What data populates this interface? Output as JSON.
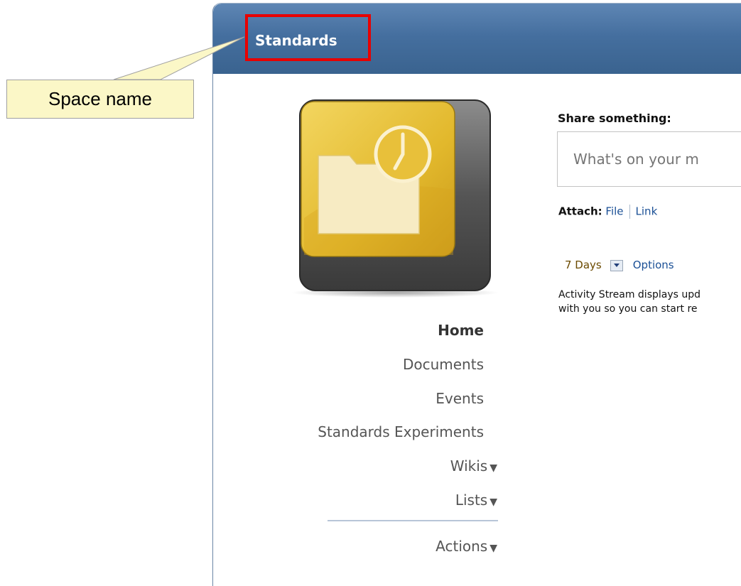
{
  "space": {
    "title": "Standards"
  },
  "callout": {
    "label": "Space name"
  },
  "nav": {
    "items": [
      {
        "label": "Home",
        "active": true,
        "has_menu": false
      },
      {
        "label": "Documents",
        "active": false,
        "has_menu": false
      },
      {
        "label": "Events",
        "active": false,
        "has_menu": false
      },
      {
        "label": "Standards Experiments",
        "active": false,
        "has_menu": false
      },
      {
        "label": "Wikis",
        "active": false,
        "has_menu": true
      },
      {
        "label": "Lists",
        "active": false,
        "has_menu": true
      }
    ],
    "actions_label": "Actions"
  },
  "share": {
    "label": "Share something:",
    "placeholder": "What's on your m",
    "attach_label": "Attach:",
    "attach_file": "File",
    "attach_link": "Link"
  },
  "filter": {
    "period": "7 Days",
    "options_label": "Options"
  },
  "activity": {
    "line1": "Activity Stream displays upd",
    "line2": "with you so you can start re"
  },
  "icons": {
    "space_icon": "folder-clock-icon",
    "menu_caret": "caret-down-icon",
    "dropdown": "dropdown-arrow-icon"
  },
  "colors": {
    "header": "#456f9f",
    "highlight": "#e80000",
    "callout_bg": "#fbf7c7",
    "link": "#1b5096"
  }
}
